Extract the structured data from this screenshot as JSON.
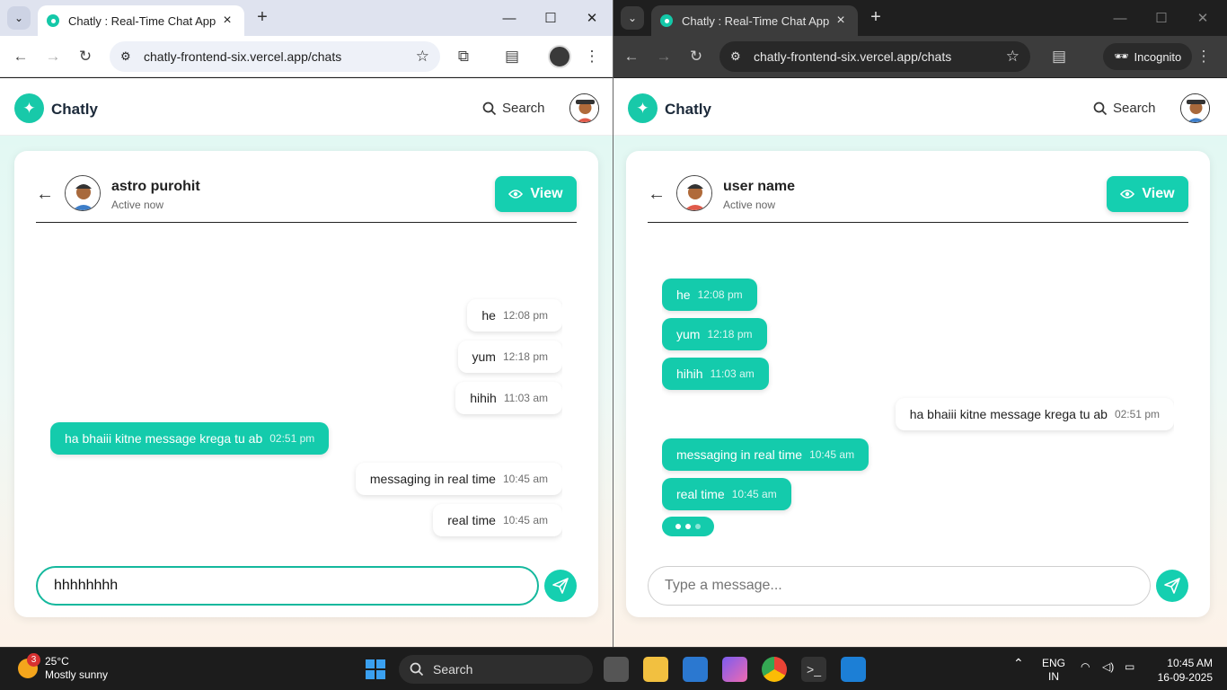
{
  "left_window": {
    "tab_title": "Chatly : Real-Time Chat App",
    "url": "chatly-frontend-six.vercel.app/chats",
    "app": {
      "brand": "Chatly",
      "search_label": "Search"
    },
    "chat": {
      "name": "astro purohit",
      "status": "Active now",
      "view_label": "View",
      "messages": [
        {
          "text": "he",
          "time": "12:08 pm",
          "side": "received"
        },
        {
          "text": "yum",
          "time": "12:18 pm",
          "side": "received"
        },
        {
          "text": "hihih",
          "time": "11:03 am",
          "side": "received"
        },
        {
          "text": "ha bhaiii kitne message krega tu ab",
          "time": "02:51 pm",
          "side": "sent"
        },
        {
          "text": "messaging in real time",
          "time": "10:45 am",
          "side": "received"
        },
        {
          "text": "real time",
          "time": "10:45 am",
          "side": "received"
        }
      ],
      "input_value": "hhhhhhhh",
      "input_placeholder": "Type a message..."
    }
  },
  "right_window": {
    "tab_title": "Chatly : Real-Time Chat App",
    "url": "chatly-frontend-six.vercel.app/chats",
    "incognito_label": "Incognito",
    "app": {
      "brand": "Chatly",
      "search_label": "Search"
    },
    "chat": {
      "name": "user name",
      "status": "Active now",
      "view_label": "View",
      "messages": [
        {
          "text": "he",
          "time": "12:08 pm",
          "side": "sent"
        },
        {
          "text": "yum",
          "time": "12:18 pm",
          "side": "sent"
        },
        {
          "text": "hihih",
          "time": "11:03 am",
          "side": "sent"
        },
        {
          "text": "ha bhaiii kitne message krega tu ab",
          "time": "02:51 pm",
          "side": "received"
        },
        {
          "text": "messaging in real time",
          "time": "10:45 am",
          "side": "sent"
        },
        {
          "text": "real time",
          "time": "10:45 am",
          "side": "sent"
        }
      ],
      "typing_indicator": true,
      "input_value": "",
      "input_placeholder": "Type a message..."
    }
  },
  "taskbar": {
    "weather_temp": "25°C",
    "weather_desc": "Mostly sunny",
    "weather_badge": "3",
    "search_label": "Search",
    "lang_top": "ENG",
    "lang_bottom": "IN",
    "time": "10:45 AM",
    "date": "16-09-2025"
  },
  "colors": {
    "accent": "#15cfb0",
    "chrome_light": "#dfe3ef",
    "chrome_dark": "#1f1f1f",
    "taskbar": "#1c1c1c"
  }
}
